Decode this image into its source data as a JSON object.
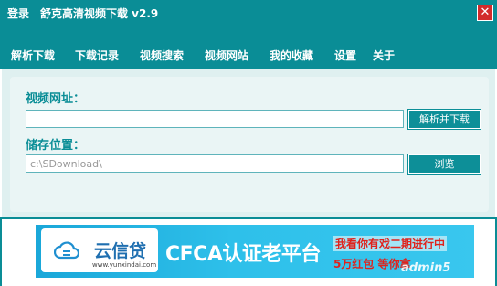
{
  "title_bar": {
    "login_label": "登录",
    "app_title": "舒克高清视频下载 v2.9",
    "close_glyph": "✕"
  },
  "menu": {
    "items": [
      "解析下载",
      "下载记录",
      "视频搜索",
      "视频网站",
      "我的收藏",
      "设置",
      "关于"
    ]
  },
  "form": {
    "url_label": "视频网址：",
    "url_value": "",
    "parse_button": "解析并下载",
    "location_label": "储存位置：",
    "location_value": "c:\\SDownload\\",
    "browse_button": "浏览"
  },
  "ad": {
    "logo_text": "云信贷",
    "logo_domain": "www.yunxindai.com",
    "headline": "CFCA认证老平台",
    "promo_line1": "我看你有戏二期进行中",
    "promo_line2": "5万红包 等你拿",
    "watermark": "admin5"
  },
  "colors": {
    "accent": "#0a8d96",
    "panel": "#eaf5f5",
    "close": "#d22b2b",
    "promo_red": "#e0221c",
    "banner_blue": "#2ec0ea"
  }
}
